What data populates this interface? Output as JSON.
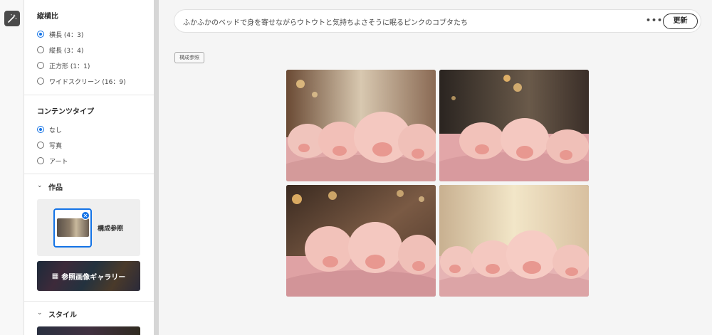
{
  "rail": {
    "tool_icon": "magic-wand-icon"
  },
  "panel": {
    "aspect_ratio": {
      "title": "縦横比",
      "options": [
        "横長 (4：3)",
        "縦長 (3：4)",
        "正方形 (1：1)",
        "ワイドスクリーン (16：9)"
      ],
      "selected": 0
    },
    "content_type": {
      "title": "コンテンツタイプ",
      "options": [
        "なし",
        "写真",
        "アート"
      ],
      "selected": 0
    },
    "works": {
      "title": "作品",
      "reference_label": "構成参照",
      "gallery_label": "参照画像ギャラリー"
    },
    "style": {
      "title": "スタイル"
    }
  },
  "main": {
    "prompt": "ふかふかのベッドで身を寄せながらウトウトと気持ちよさそうに眠るピンクのコブタたち",
    "more_icon": "more-horizontal-icon",
    "refresh_label": "更新",
    "tag_label": "構成参照",
    "results": [
      "result-1",
      "result-2",
      "result-3",
      "result-4"
    ]
  },
  "colors": {
    "accent": "#1473e6",
    "piglet_pink": "#f0b8b0",
    "blanket": "#e0a8a8"
  }
}
